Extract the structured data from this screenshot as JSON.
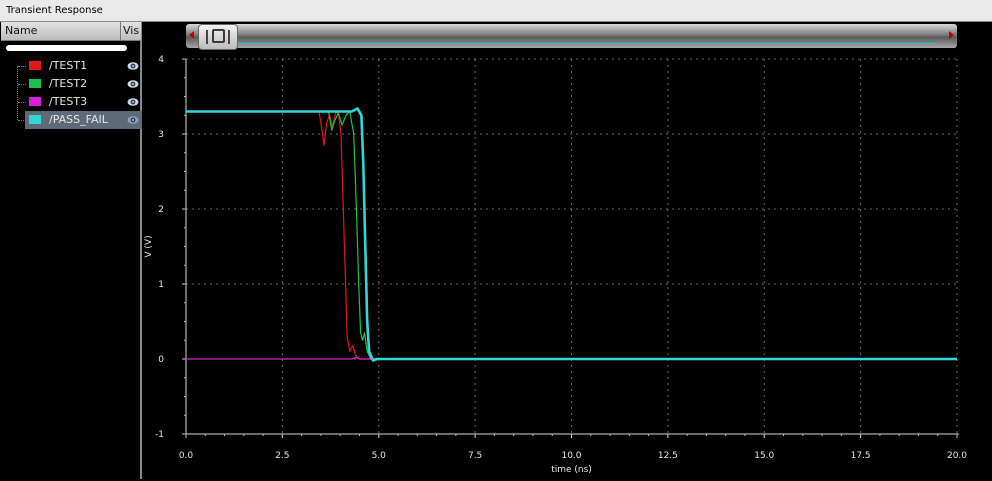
{
  "window": {
    "title": "Transient Response"
  },
  "sidebar": {
    "col_name": "Name",
    "col_vis": "Vis",
    "signals": [
      {
        "label": "/TEST1",
        "color": "#e01818",
        "selected": false
      },
      {
        "label": "/TEST2",
        "color": "#1fbf4f",
        "selected": false
      },
      {
        "label": "/TEST3",
        "color": "#d61fd6",
        "selected": false
      },
      {
        "label": "/PASS_FAIL",
        "color": "#33d6d6",
        "selected": true
      }
    ]
  },
  "chart_data": {
    "type": "line",
    "xlabel": "time (ns)",
    "ylabel": "V (V)",
    "xlim": [
      0,
      20
    ],
    "ylim": [
      -1,
      4
    ],
    "x_ticks": [
      "0.0",
      "2.5",
      "5.0",
      "7.5",
      "10.0",
      "12.5",
      "15.0",
      "17.5",
      "20.0"
    ],
    "y_ticks": [
      "4",
      "3",
      "2",
      "1",
      "0",
      "-1"
    ],
    "grid": true,
    "background": "#000000",
    "series": [
      {
        "name": "/TEST1",
        "color": "#e01818",
        "points": [
          [
            0,
            3.3
          ],
          [
            3.45,
            3.3
          ],
          [
            3.5,
            3.15
          ],
          [
            3.58,
            2.85
          ],
          [
            3.65,
            3.15
          ],
          [
            3.72,
            3.25
          ],
          [
            3.8,
            3.1
          ],
          [
            3.88,
            3.28
          ],
          [
            3.95,
            3.3
          ],
          [
            4.02,
            3.0
          ],
          [
            4.08,
            2.0
          ],
          [
            4.14,
            1.0
          ],
          [
            4.18,
            0.3
          ],
          [
            4.25,
            0.1
          ],
          [
            4.32,
            0.18
          ],
          [
            4.4,
            0.05
          ],
          [
            4.5,
            0.0
          ],
          [
            20,
            0.0
          ]
        ]
      },
      {
        "name": "/TEST2",
        "color": "#1fbf4f",
        "points": [
          [
            0,
            3.3
          ],
          [
            3.7,
            3.3
          ],
          [
            3.78,
            3.05
          ],
          [
            3.86,
            3.18
          ],
          [
            3.95,
            3.28
          ],
          [
            4.05,
            3.12
          ],
          [
            4.15,
            3.25
          ],
          [
            4.25,
            3.3
          ],
          [
            4.35,
            3.0
          ],
          [
            4.42,
            2.0
          ],
          [
            4.48,
            1.0
          ],
          [
            4.53,
            0.35
          ],
          [
            4.58,
            0.25
          ],
          [
            4.63,
            0.35
          ],
          [
            4.7,
            0.1
          ],
          [
            4.8,
            0.0
          ],
          [
            20,
            0.0
          ]
        ]
      },
      {
        "name": "/TEST3",
        "color": "#d61fd6",
        "points": [
          [
            0,
            0.0
          ],
          [
            4.3,
            0.0
          ],
          [
            4.4,
            0.02
          ],
          [
            4.5,
            0.0
          ],
          [
            20,
            0.0
          ]
        ]
      },
      {
        "name": "/PASS_FAIL",
        "color": "#33d6d6",
        "points": [
          [
            0,
            3.3
          ],
          [
            4.3,
            3.3
          ],
          [
            4.45,
            3.34
          ],
          [
            4.55,
            3.25
          ],
          [
            4.6,
            2.6
          ],
          [
            4.65,
            1.5
          ],
          [
            4.7,
            0.5
          ],
          [
            4.75,
            0.1
          ],
          [
            4.85,
            -0.02
          ],
          [
            4.95,
            0.0
          ],
          [
            20,
            0.0
          ]
        ]
      }
    ]
  }
}
